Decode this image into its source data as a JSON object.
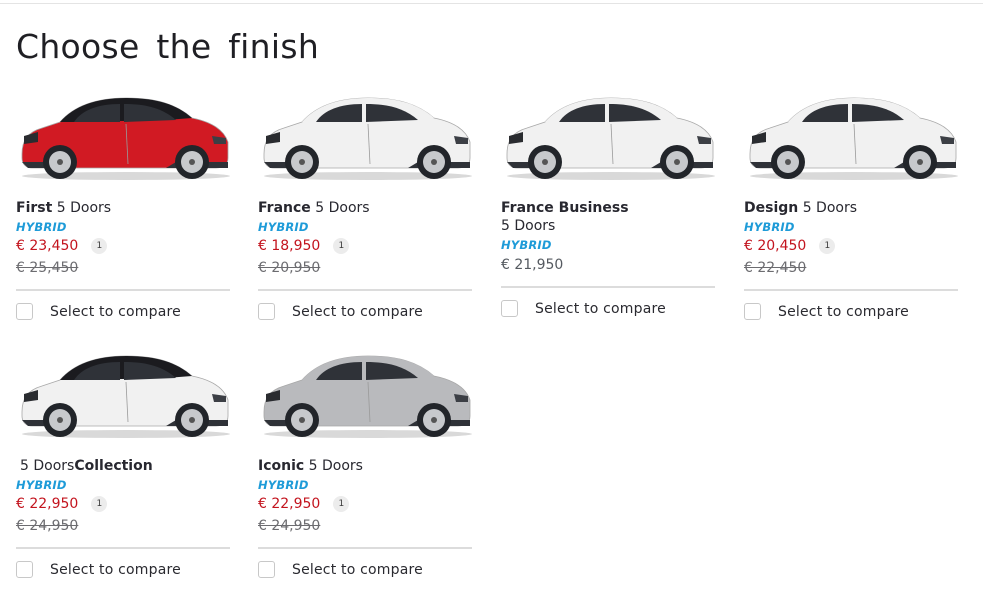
{
  "page": {
    "title": "Choose the finish"
  },
  "labels": {
    "hybrid": "HYBRID",
    "compare": "Select to compare"
  },
  "cars": [
    {
      "name": "First",
      "doors": "5 Doors",
      "price": "€ 23,450",
      "old_price": "€ 25,450",
      "note": "1",
      "body_color": "#d11a23",
      "roof_color": "#1b1b1f"
    },
    {
      "name": "France",
      "doors": "5 Doors",
      "price": "€ 18,950",
      "old_price": "€ 20,950",
      "note": "1",
      "body_color": "#f1f1f1",
      "roof_color": "#f1f1f1"
    },
    {
      "name": "France Business",
      "doors": "5 Doors",
      "price": "€ 21,950",
      "body_color": "#f1f1f1",
      "roof_color": "#f1f1f1"
    },
    {
      "name": "Design",
      "doors": "5 Doors",
      "price": "€ 20,450",
      "old_price": "€ 22,450",
      "note": "1",
      "body_color": "#f1f1f1",
      "roof_color": "#f1f1f1"
    },
    {
      "name": "Collection",
      "doors": "5 Doors",
      "price": "€ 22,950",
      "old_price": "€ 24,950",
      "note": "1",
      "body_color": "#f1f1f1",
      "roof_color": "#1b1b1f"
    },
    {
      "name": "Iconic",
      "doors": "5 Doors",
      "price": "€ 22,950",
      "old_price": "€ 24,950",
      "note": "1",
      "body_color": "#b9babd",
      "roof_color": "#b9babd"
    }
  ]
}
